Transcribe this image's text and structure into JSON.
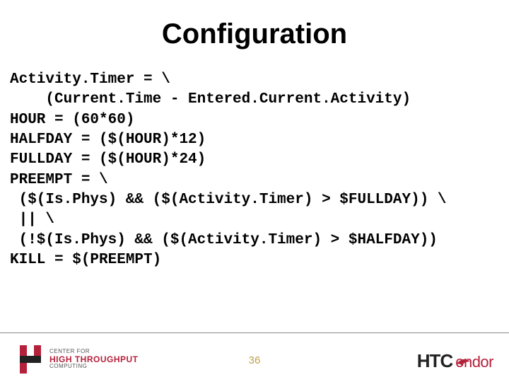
{
  "title": "Configuration",
  "code_lines": [
    "Activity.Timer = \\",
    "    (Current.Time - Entered.Current.Activity)",
    "HOUR = (60*60)",
    "HALFDAY = ($(HOUR)*12)",
    "FULLDAY = ($(HOUR)*24)",
    "PREEMPT = \\",
    " ($(Is.Phys) && ($(Activity.Timer) > $FULLDAY)) \\",
    " || \\",
    " (!$(Is.Phys) && ($(Activity.Timer) > $HALFDAY))",
    "KILL = $(PREEMPT)"
  ],
  "footer": {
    "left_logo": {
      "line1": "CENTER FOR",
      "line2": "HIGH THROUGHPUT",
      "line3": "COMPUTING"
    },
    "page_number": "36",
    "right_logo": {
      "prefix": "HTC",
      "suffix": "ondor"
    }
  }
}
